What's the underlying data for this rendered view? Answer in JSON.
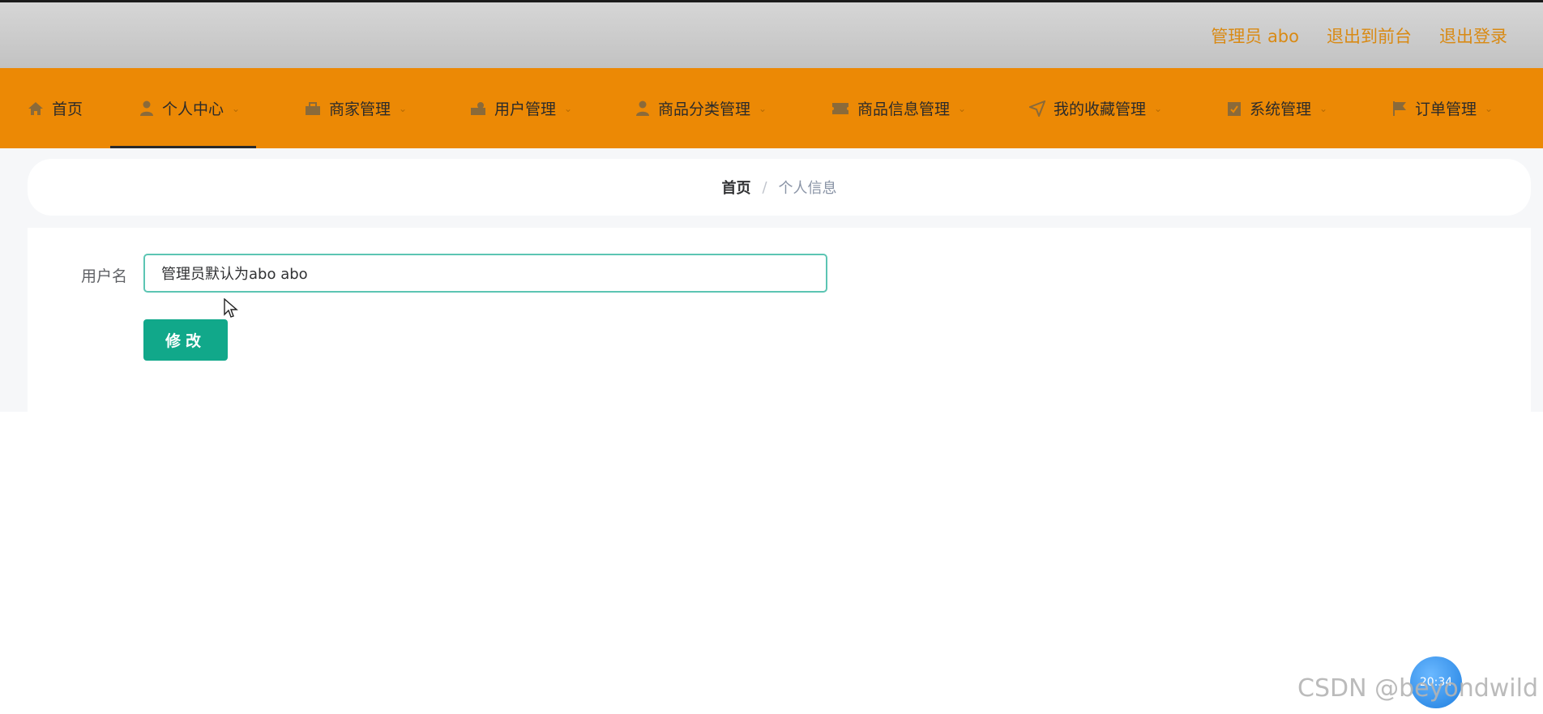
{
  "header": {
    "user_label": "管理员 abo",
    "back_to_front": "退出到前台",
    "logout": "退出登录"
  },
  "nav": {
    "items": [
      {
        "label": "首页",
        "icon": "home-icon",
        "has_dropdown": false
      },
      {
        "label": "个人中心",
        "icon": "user-icon",
        "has_dropdown": true,
        "active": true
      },
      {
        "label": "商家管理",
        "icon": "shop-icon",
        "has_dropdown": true
      },
      {
        "label": "用户管理",
        "icon": "users-icon",
        "has_dropdown": true
      },
      {
        "label": "商品分类管理",
        "icon": "user-icon",
        "has_dropdown": true
      },
      {
        "label": "商品信息管理",
        "icon": "ticket-icon",
        "has_dropdown": true
      },
      {
        "label": "我的收藏管理",
        "icon": "location-icon",
        "has_dropdown": true
      },
      {
        "label": "系统管理",
        "icon": "checklist-icon",
        "has_dropdown": true
      },
      {
        "label": "订单管理",
        "icon": "flag-icon",
        "has_dropdown": true
      }
    ],
    "chevron": "⌄"
  },
  "breadcrumb": {
    "home": "首页",
    "separator": "/",
    "current": "个人信息"
  },
  "form": {
    "username_label": "用户名",
    "username_value": "管理员默认为abo abo",
    "submit_label": "修改"
  },
  "overlay": {
    "watermark": "CSDN @beyondwild",
    "timer": "20:34"
  },
  "colors": {
    "nav_bg": "#ec8905",
    "header_link": "#d98a14",
    "button": "#11a88a",
    "input_border": "#5cc5b3"
  }
}
